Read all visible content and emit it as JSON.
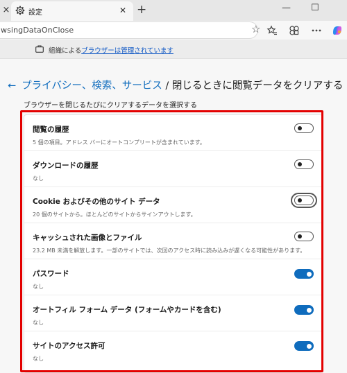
{
  "browser": {
    "tab_close_left": "×",
    "tab_title": "設定",
    "tab_close": "✕",
    "new_tab": "+",
    "window_minimize": "—",
    "window_maximize": "☐",
    "address_text": "wsingDataOnClose",
    "icons": [
      "gear-icon",
      "star-icon",
      "favorites-icon",
      "extensions-icon",
      "more-icon",
      "copilot-icon"
    ]
  },
  "managed_bar": {
    "prefix": "組織による",
    "link": "ブラウザーは管理されています"
  },
  "header": {
    "back_arrow": "←",
    "breadcrumb_link": "プライバシー、検索、サービス",
    "separator": " / ",
    "current": "閉じるときに閲覧データをクリアする"
  },
  "subtitle": "ブラウザーを閉じるたびにクリアするデータを選択する",
  "settings": [
    {
      "label": "閲覧の履歴",
      "desc": "5 個の項目。アドレス バーにオートコンプリートが含まれています。",
      "enabled": false
    },
    {
      "label": "ダウンロードの履歴",
      "desc": "なし",
      "enabled": false
    },
    {
      "label": "Cookie およびその他のサイト データ",
      "desc": "20 個のサイトから。ほとんどのサイトからサインアウトします。",
      "enabled": false
    },
    {
      "label": "キャッシュされた画像とファイル",
      "desc": "23.2 MB 未満を解放します。一部のサイトでは、次回のアクセス時に読み込みが遅くなる可能性があります。",
      "enabled": false
    },
    {
      "label": "パスワード",
      "desc": "なし",
      "enabled": true
    },
    {
      "label": "オートフィル フォーム データ (フォームやカードを含む)",
      "desc": "なし",
      "enabled": true
    },
    {
      "label": "サイトのアクセス許可",
      "desc": "なし",
      "enabled": true
    }
  ],
  "colors": {
    "accent": "#0f6cbd",
    "highlight": "#e30000"
  }
}
